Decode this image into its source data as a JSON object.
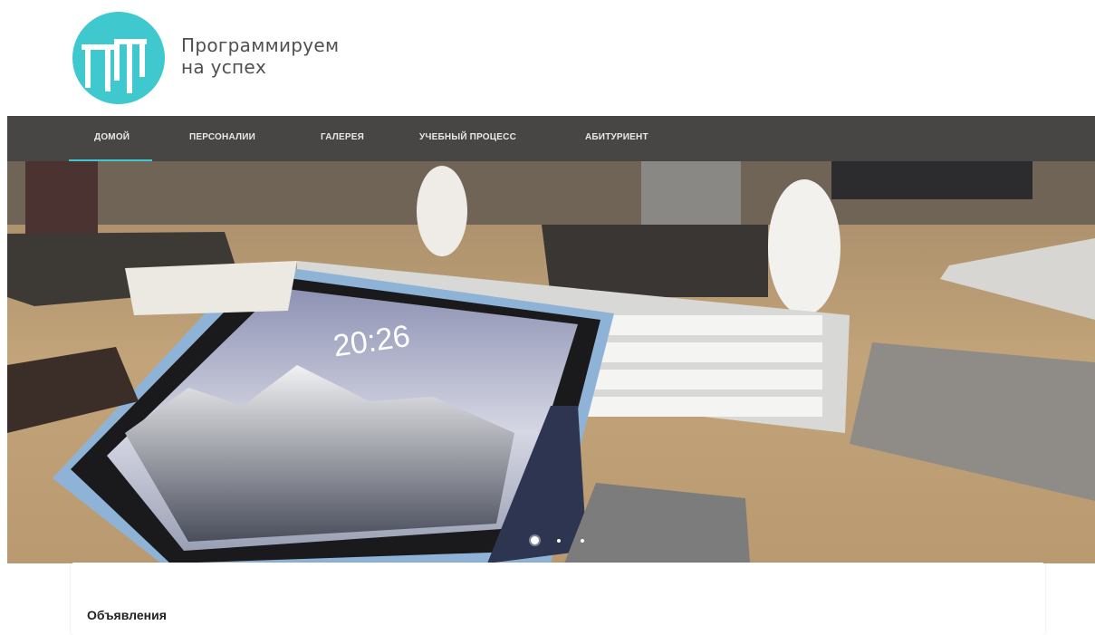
{
  "brand": {
    "tagline_line1": "Программируем",
    "tagline_line2": "на успех",
    "logo_color": "#3fc9cf",
    "logo_icon": "pit-logo-icon"
  },
  "nav": {
    "items": [
      {
        "label": "ДОМОЙ",
        "active": true
      },
      {
        "label": "ПЕРСОНАЛИИ",
        "active": false
      },
      {
        "label": "ГАЛЕРЕЯ",
        "active": false
      },
      {
        "label": "УЧЕБНЫЙ ПРОЦЕСС",
        "active": false
      },
      {
        "label": "АБИТУРИЕНТ",
        "active": false
      }
    ],
    "background": "#474644",
    "accent": "#3fc9cf"
  },
  "hero": {
    "tablet_clock": "20:26",
    "slides_count": 3,
    "active_slide": 1
  },
  "notice": {
    "title": "Объявления"
  }
}
